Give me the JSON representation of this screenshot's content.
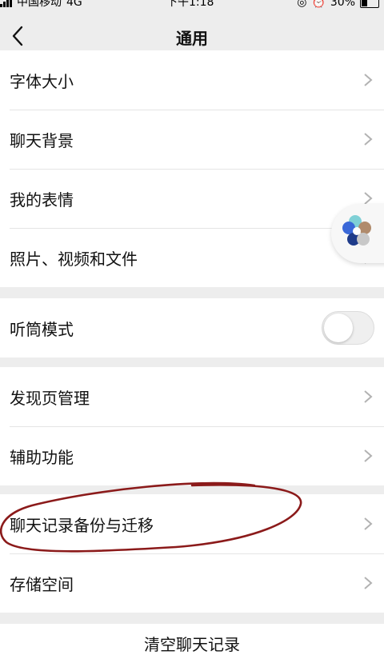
{
  "status_bar": {
    "carrier": "中国移动",
    "network": "4G",
    "time": "下午1:18",
    "battery": "30%"
  },
  "header": {
    "title": "通用"
  },
  "group1": {
    "items": [
      {
        "label": "字体大小"
      },
      {
        "label": "聊天背景"
      },
      {
        "label": "我的表情"
      },
      {
        "label": "照片、视频和文件"
      }
    ]
  },
  "group2": {
    "items": [
      {
        "label": "听筒模式",
        "toggle_on": false
      }
    ]
  },
  "group3": {
    "items": [
      {
        "label": "发现页管理"
      },
      {
        "label": "辅助功能"
      }
    ]
  },
  "group4": {
    "items": [
      {
        "label": "聊天记录备份与迁移"
      },
      {
        "label": "存储空间"
      }
    ]
  },
  "footer": {
    "clear_label": "清空聊天记录"
  },
  "colors": {
    "background": "#ededed",
    "annotation": "#8b1a1a"
  }
}
